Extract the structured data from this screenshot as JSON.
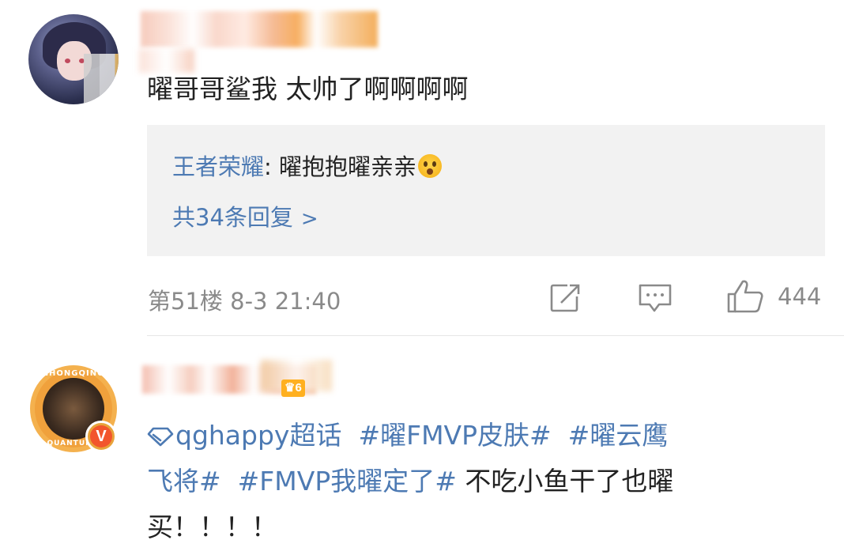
{
  "comment1": {
    "text": "曜哥哥鲨我 太帅了啊啊啊啊",
    "reply_preview": {
      "user": "王者荣耀",
      "separator": ": ",
      "text": "曜抱抱曜亲亲",
      "emoji": "surprised-emoji-icon"
    },
    "reply_count_label": "共34条回复",
    "reply_count_chevron": ">",
    "meta": "第51楼 8-3 21:40",
    "like_count": "444"
  },
  "comment2": {
    "avatar_ring_top": "CHONGQING",
    "avatar_ring_bottom": "QUANTUMG",
    "verified_badge": "V",
    "level_badge": "6",
    "super_topic": "qghappy超话",
    "topic1": "#曜FMVP皮肤#",
    "topic2_part1": "#曜云鹰",
    "topic2_part2": "飞将#",
    "topic3": "#FMVP我曜定了#",
    "text_part1": "不吃小鱼干了也曜",
    "text_part2": "买！！！！"
  },
  "colors": {
    "link_blue": "#4d7ab3",
    "meta_gray": "#8a8a8a",
    "reply_bg": "#f2f2f2",
    "verified_orange": "#f2552c",
    "level_yellow": "#ffb020"
  }
}
